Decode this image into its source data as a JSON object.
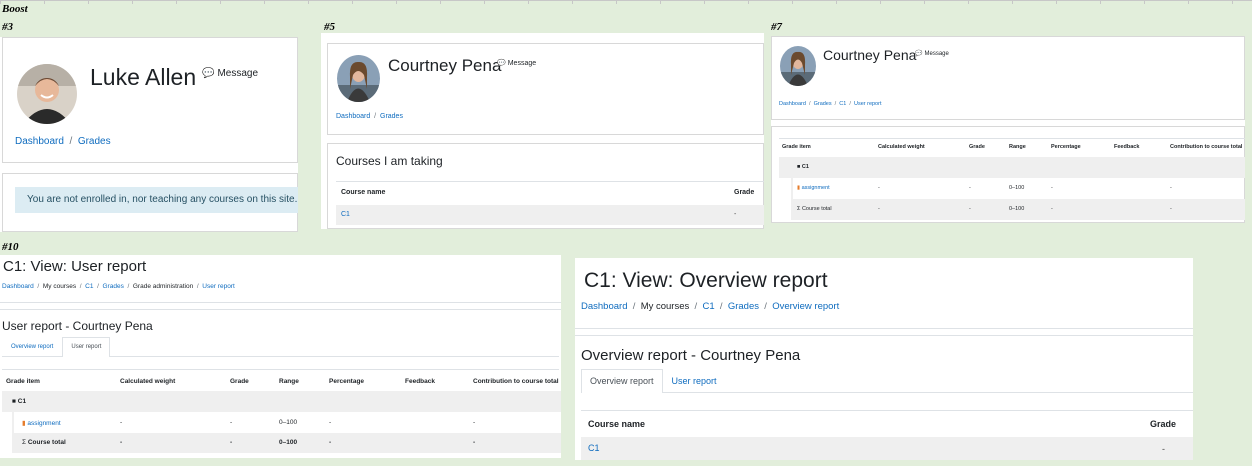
{
  "labels": {
    "boost": "Boost",
    "n3": "#3",
    "n5": "#5",
    "n7": "#7",
    "n10": "#10"
  },
  "panel3": {
    "name": "Luke Allen",
    "message": "Message",
    "breadcrumb": [
      "Dashboard",
      "Grades"
    ],
    "notice": "You are not enrolled in, nor teaching any courses on this site."
  },
  "panel5": {
    "name": "Courtney Pena",
    "message": "Message",
    "breadcrumb": [
      "Dashboard",
      "Grades"
    ],
    "courses_title": "Courses I am taking",
    "headers": [
      "Course name",
      "Grade"
    ],
    "rows": [
      [
        "C1",
        "-"
      ]
    ]
  },
  "panel7": {
    "name": "Courtney Pena",
    "message": "Message",
    "breadcrumb": [
      "Dashboard",
      "Grades",
      "C1",
      "User report"
    ],
    "headers": [
      "Grade item",
      "Calculated weight",
      "Grade",
      "Range",
      "Percentage",
      "Feedback",
      "Contribution to course total"
    ],
    "category": "C1",
    "rows": [
      {
        "item": "assignment",
        "weight": "-",
        "grade": "-",
        "range": "0–100",
        "pct": "-",
        "contrib": "-"
      },
      {
        "item": "Course total",
        "weight": "-",
        "grade": "-",
        "range": "0–100",
        "pct": "-",
        "contrib": "-"
      }
    ]
  },
  "panel10": {
    "title": "C1: View: User report",
    "breadcrumb": [
      "Dashboard",
      "My courses",
      "C1",
      "Grades",
      "Grade administration",
      "User report"
    ],
    "subtitle": "User report - Courtney Pena",
    "tabs": [
      "Overview report",
      "User report"
    ],
    "headers": [
      "Grade item",
      "Calculated weight",
      "Grade",
      "Range",
      "Percentage",
      "Feedback",
      "Contribution to course total"
    ],
    "category": "C1",
    "rows": [
      {
        "item": "assignment",
        "weight": "-",
        "grade": "-",
        "range": "0–100",
        "pct": "-",
        "contrib": "-"
      },
      {
        "item": "Course total",
        "weight": "-",
        "grade": "-",
        "range": "0–100",
        "pct": "-",
        "contrib": "-"
      }
    ]
  },
  "panelOverview": {
    "title": "C1: View: Overview report",
    "breadcrumb": [
      "Dashboard",
      "My courses",
      "C1",
      "Grades",
      "Overview report"
    ],
    "subtitle": "Overview report - Courtney Pena",
    "tabs": [
      "Overview report",
      "User report"
    ],
    "headers": [
      "Course name",
      "Grade"
    ],
    "rows": [
      [
        "C1",
        "-"
      ]
    ]
  }
}
